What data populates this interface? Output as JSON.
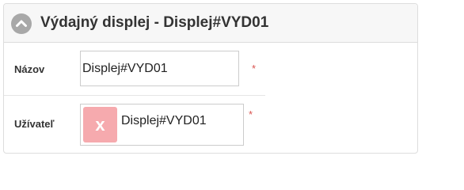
{
  "header": {
    "title": "Výdajný displej - Displej#VYD01",
    "collapse_icon": "chevron-up-icon"
  },
  "form": {
    "name_field": {
      "label": "Názov",
      "value": "Displej#VYD01",
      "required_marker": "*"
    },
    "user_field": {
      "label": "Užívateľ",
      "selected_tag": "Displej#VYD01",
      "remove_label": "x",
      "required_marker": "*"
    }
  },
  "colors": {
    "tag_remove_bg": "#f6aaae",
    "required": "#d9534f",
    "collapse_button": "#a8a8a8"
  }
}
